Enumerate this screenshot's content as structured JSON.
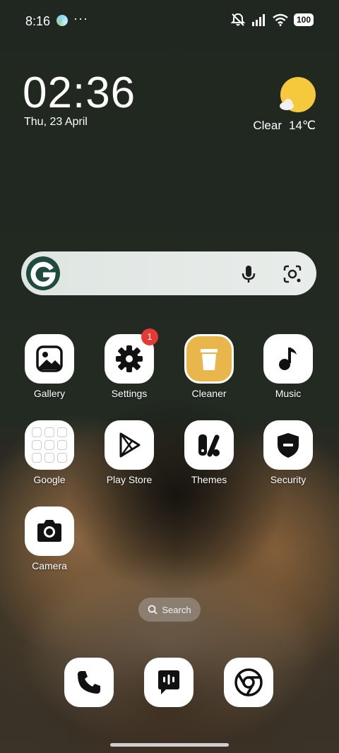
{
  "status_bar": {
    "time": "8:16",
    "dots": "···",
    "battery": "100"
  },
  "clock_widget": {
    "time": "02:36",
    "date": "Thu, 23 April"
  },
  "weather_widget": {
    "condition": "Clear",
    "temperature": "14℃"
  },
  "search_widget": {
    "logo": "G",
    "icons": [
      "mic-icon",
      "google-lens-icon"
    ]
  },
  "apps": [
    {
      "label": "Gallery",
      "icon": "gallery-icon"
    },
    {
      "label": "Settings",
      "icon": "gear-icon",
      "badge": "1"
    },
    {
      "label": "Cleaner",
      "icon": "trash-icon"
    },
    {
      "label": "Music",
      "icon": "music-note-icon"
    },
    {
      "label": "Google",
      "icon": "folder-icon"
    },
    {
      "label": "Play Store",
      "icon": "play-store-icon"
    },
    {
      "label": "Themes",
      "icon": "themes-icon"
    },
    {
      "label": "Security",
      "icon": "shield-icon"
    },
    {
      "label": "Camera",
      "icon": "camera-icon"
    }
  ],
  "app_search": {
    "label": "Search"
  },
  "dock": [
    {
      "icon": "phone-icon"
    },
    {
      "icon": "messages-icon"
    },
    {
      "icon": "chrome-icon"
    }
  ],
  "colors": {
    "badge": "#e53935",
    "cleaner_bg": "#e8b64a",
    "weather_sun": "#f6c83c",
    "google_logo_bg": "#1f4a3d"
  }
}
